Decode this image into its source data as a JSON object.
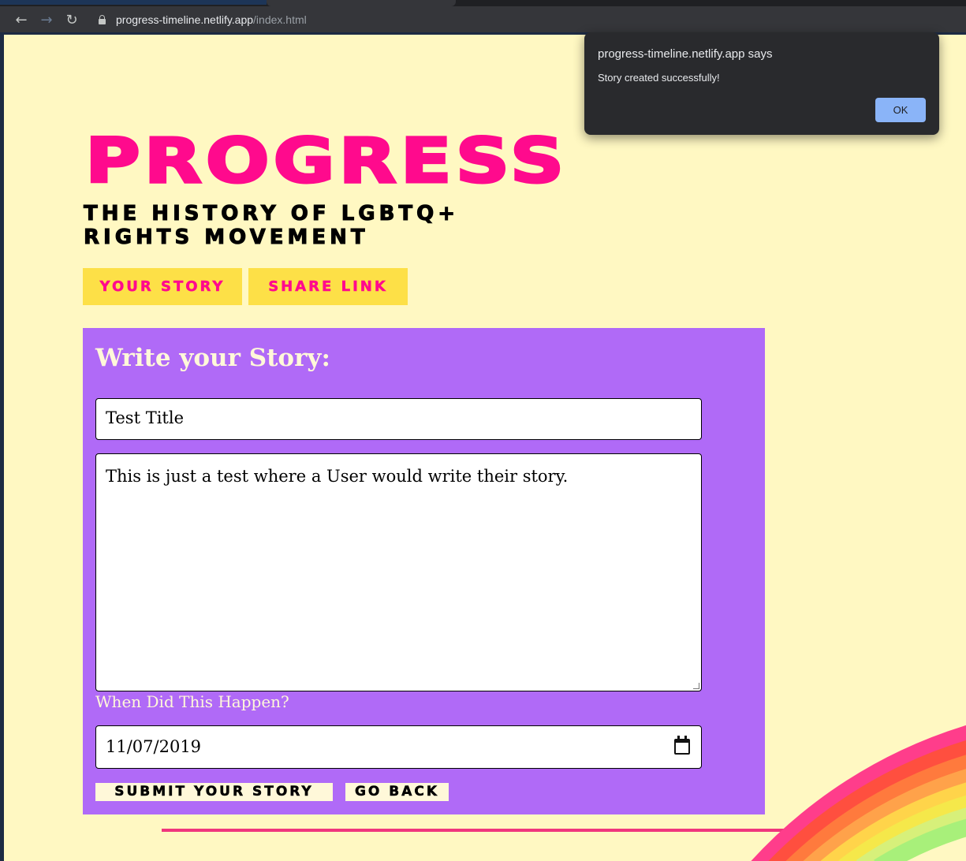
{
  "browser": {
    "url_host": "progress-timeline.netlify.app",
    "url_path": "/index.html",
    "back_icon": "arrow-left-icon",
    "forward_icon": "arrow-right-icon",
    "reload_icon": "reload-icon"
  },
  "header": {
    "brand": "PROGRESS",
    "subtitle": "THE HISTORY OF LGBTQ+ RIGHTS MOVEMENT"
  },
  "nav": {
    "your_story": "YOUR STORY",
    "share_link": "SHARE LINK"
  },
  "form": {
    "heading": "Write your Story:",
    "title_value": "Test Title",
    "story_value": "This is just a test where a User would write their story.",
    "date_label": "When Did This Happen?",
    "date_value": "11/07/2019",
    "submit_label": "SUBMIT YOUR STORY",
    "back_label": "GO BACK"
  },
  "alert": {
    "title": "progress-timeline.netlify.app says",
    "message": "Story created successfully!",
    "ok_label": "OK"
  },
  "colors": {
    "page_bg": "#fff8c2",
    "brand_pink": "#ff0a8d",
    "nav_yellow": "#fde047",
    "card_purple": "#b06af7",
    "rule_pink": "#f0367d",
    "alert_bg": "#292a2d",
    "alert_button": "#8ab4f8"
  }
}
